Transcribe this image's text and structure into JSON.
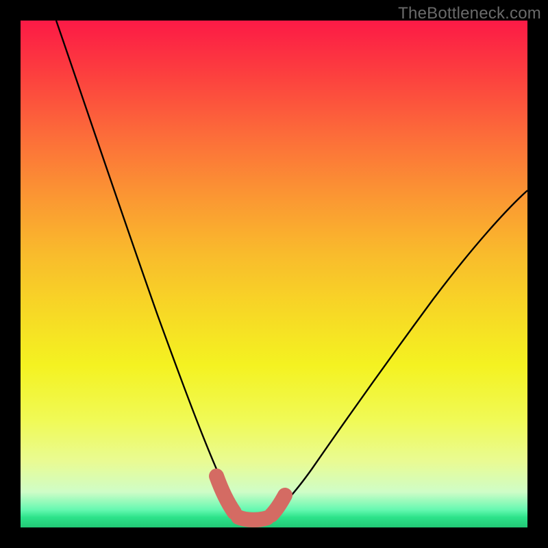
{
  "attribution": "TheBottleneck.com",
  "chart_data": {
    "type": "line",
    "title": "",
    "xlabel": "",
    "ylabel": "",
    "xlim": [
      0,
      100
    ],
    "ylim": [
      0,
      100
    ],
    "grid": false,
    "legend": false,
    "background_gradient": {
      "top": "#fc1a46",
      "middle": "#f7e623",
      "bottom": "#22c876"
    },
    "series": [
      {
        "name": "left_curve",
        "color": "#000000",
        "x": [
          7,
          10,
          14,
          18,
          22,
          26,
          30,
          33,
          36,
          38,
          40,
          42,
          43
        ],
        "values": [
          100,
          90,
          78,
          66,
          54,
          42,
          30,
          20,
          13,
          8,
          5,
          3,
          2
        ]
      },
      {
        "name": "right_curve",
        "color": "#000000",
        "x": [
          49,
          52,
          56,
          60,
          65,
          70,
          76,
          82,
          88,
          94,
          100
        ],
        "values": [
          2,
          4,
          8,
          13,
          19,
          26,
          34,
          42,
          50,
          58,
          66
        ]
      },
      {
        "name": "trough_highlight",
        "comment": "coral overlay emphasizing approximate minimum region",
        "color": "#d46b63",
        "x": [
          39,
          41,
          43,
          46,
          49,
          51
        ],
        "values": [
          8,
          4,
          2,
          2,
          2,
          5
        ]
      }
    ]
  }
}
